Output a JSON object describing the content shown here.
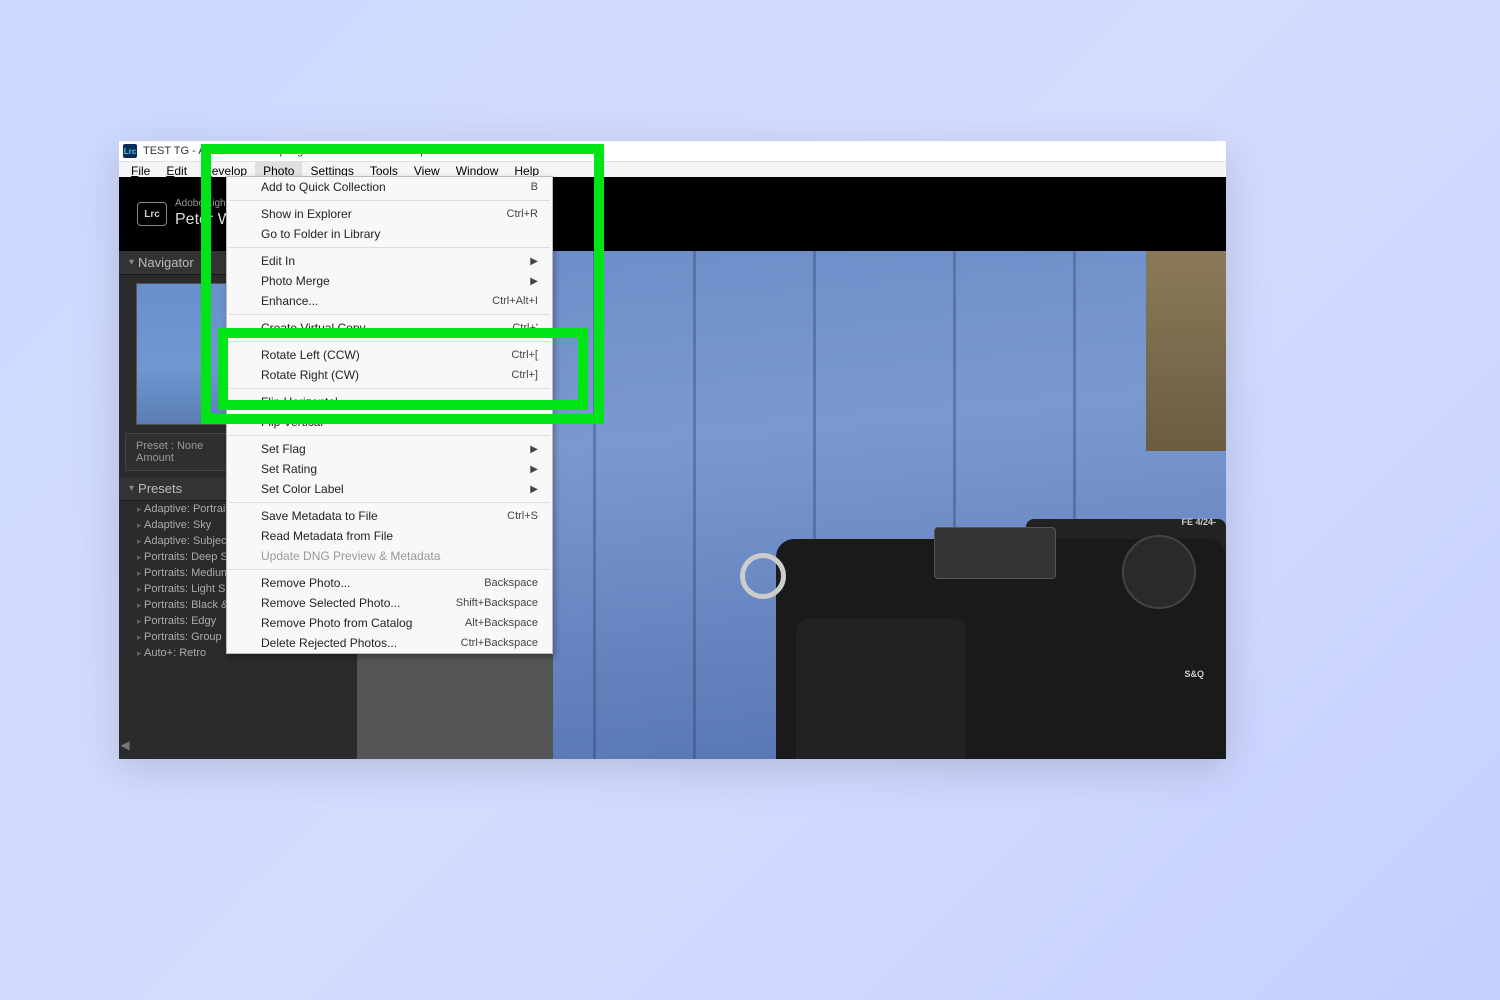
{
  "window": {
    "title": "TEST TG - Adobe Photoshop Lightroom Classic - Develop",
    "icon_label": "Lrc"
  },
  "menubar": {
    "items": [
      "File",
      "Edit",
      "Develop",
      "Photo",
      "Settings",
      "Tools",
      "View",
      "Window",
      "Help"
    ],
    "active_index": 3
  },
  "brand": {
    "small": "Adobe Lightroom Classic",
    "big": "Peter Wolinski"
  },
  "left_panel": {
    "navigator_title": "Navigator",
    "preset_label": "Preset :",
    "preset_value": "None",
    "amount_label": "Amount",
    "presets_title": "Presets",
    "presets": [
      "Adaptive: Portrait",
      "Adaptive: Sky",
      "Adaptive: Subject",
      "Portraits: Deep Skin",
      "Portraits: Medium Skin",
      "Portraits: Light Skin",
      "Portraits: Black & White",
      "Portraits: Edgy",
      "Portraits: Group",
      "Auto+: Retro"
    ]
  },
  "dropdown": {
    "sections": [
      [
        {
          "label": "Add to Quick Collection",
          "shortcut": "B"
        }
      ],
      [
        {
          "label": "Show in Explorer",
          "shortcut": "Ctrl+R"
        },
        {
          "label": "Go to Folder in Library",
          "shortcut": ""
        }
      ],
      [
        {
          "label": "Edit In",
          "submenu": true
        },
        {
          "label": "Photo Merge",
          "submenu": true
        },
        {
          "label": "Enhance...",
          "shortcut": "Ctrl+Alt+I"
        }
      ],
      [
        {
          "label": "Create Virtual Copy",
          "shortcut": "Ctrl+'"
        }
      ],
      [
        {
          "label": "Rotate Left (CCW)",
          "shortcut": "Ctrl+["
        },
        {
          "label": "Rotate Right (CW)",
          "shortcut": "Ctrl+]"
        }
      ],
      [
        {
          "label": "Flip Horizontal"
        },
        {
          "label": "Flip Vertical"
        }
      ],
      [
        {
          "label": "Set Flag",
          "submenu": true
        },
        {
          "label": "Set Rating",
          "submenu": true
        },
        {
          "label": "Set Color Label",
          "submenu": true
        }
      ],
      [
        {
          "label": "Save Metadata to File",
          "shortcut": "Ctrl+S"
        },
        {
          "label": "Read Metadata from File"
        },
        {
          "label": "Update DNG Preview & Metadata",
          "disabled": true
        }
      ],
      [
        {
          "label": "Remove Photo...",
          "shortcut": "Backspace"
        },
        {
          "label": "Remove Selected Photo...",
          "shortcut": "Shift+Backspace"
        },
        {
          "label": "Remove Photo from Catalog",
          "shortcut": "Alt+Backspace"
        },
        {
          "label": "Delete Rejected Photos...",
          "shortcut": "Ctrl+Backspace"
        }
      ]
    ]
  },
  "camera_labels": {
    "lens": "FE 4/24-",
    "sq": "S&Q"
  }
}
